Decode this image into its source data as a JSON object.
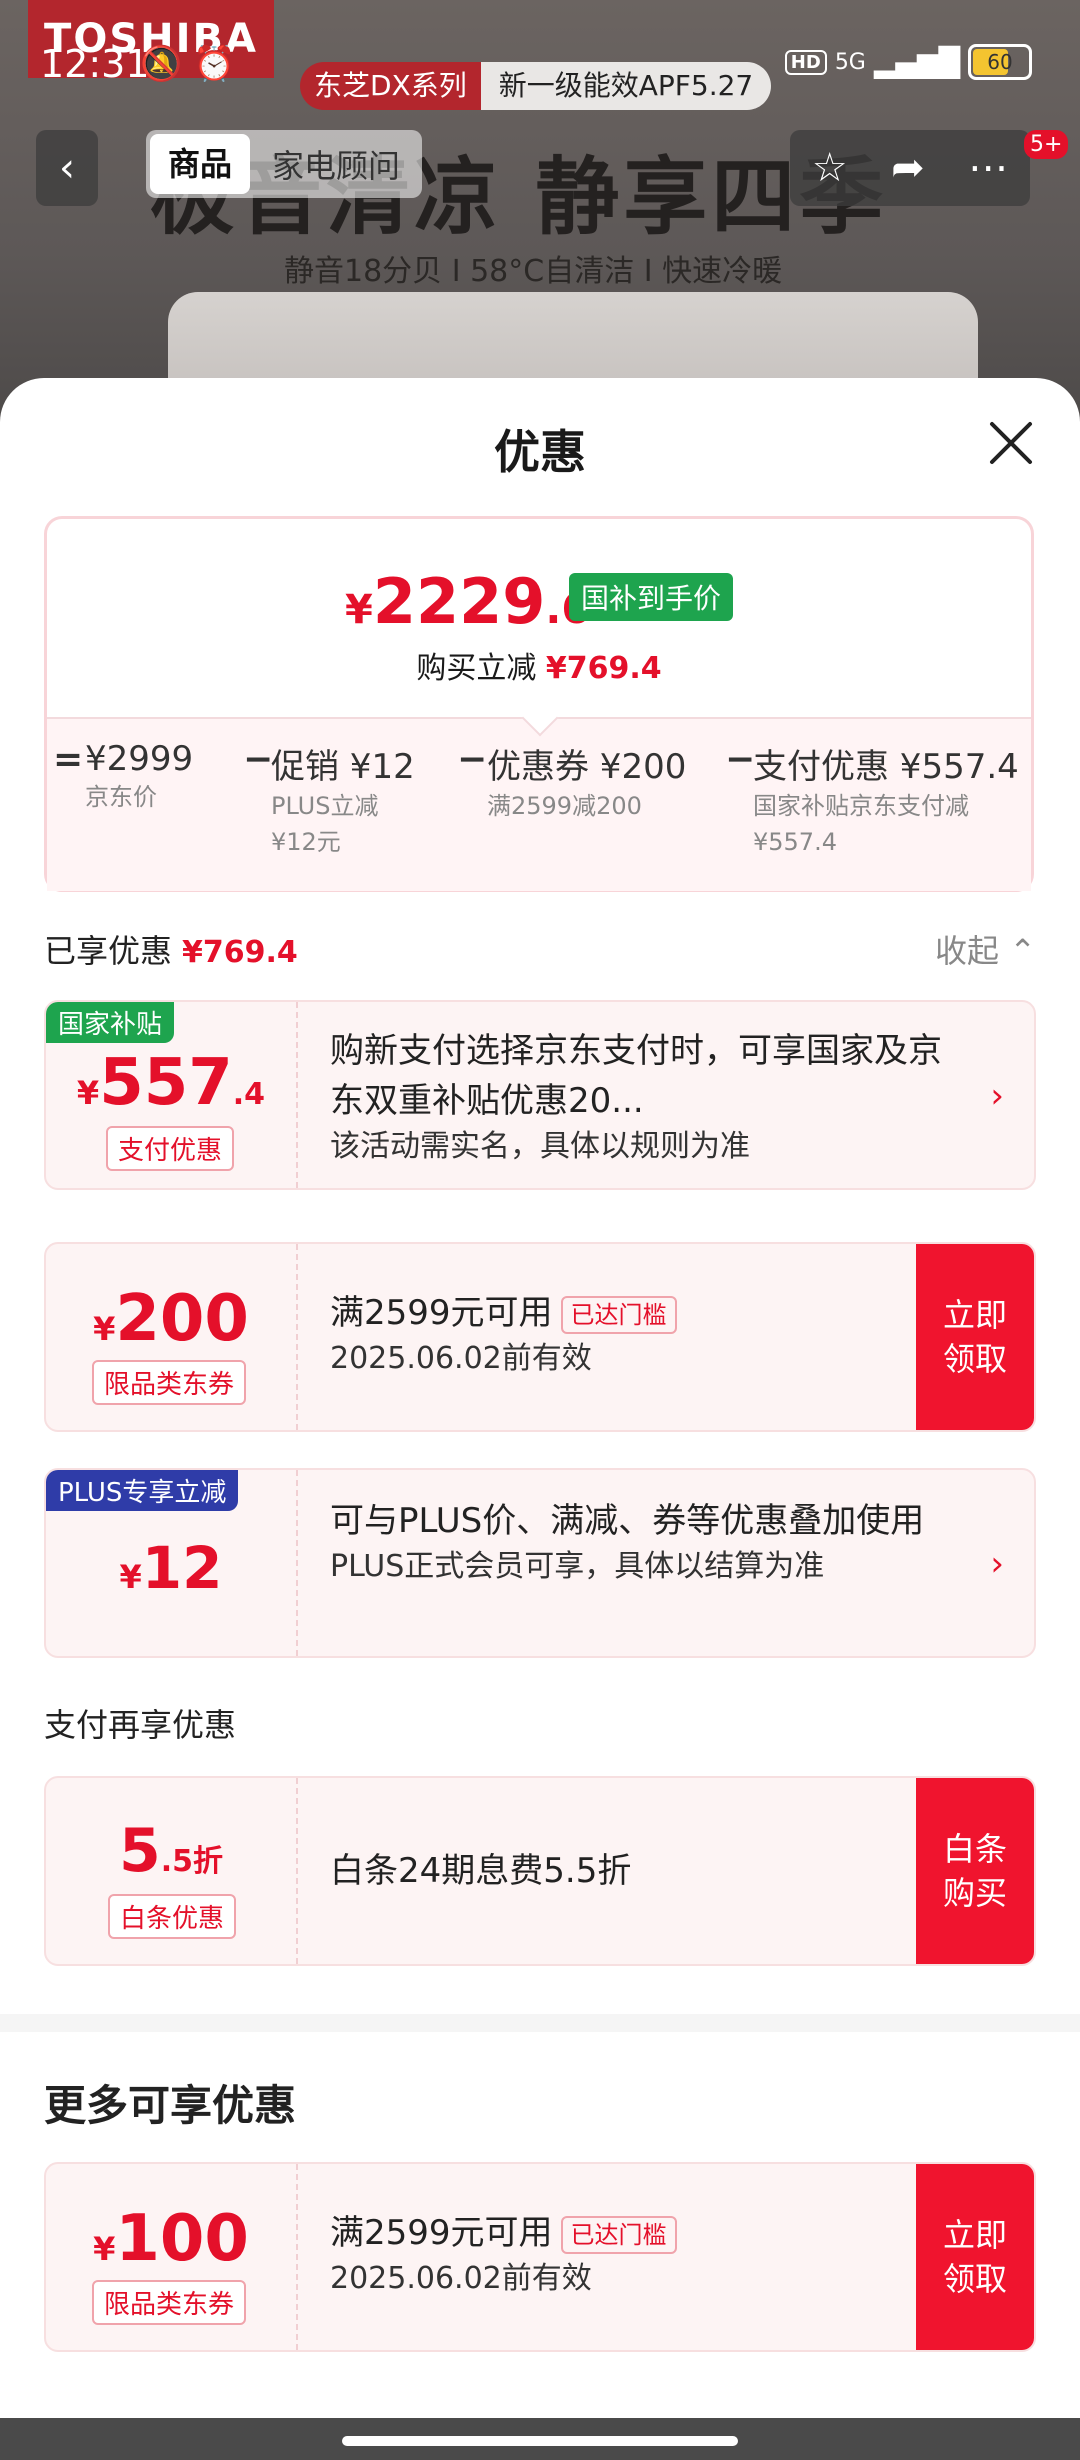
{
  "background": {
    "brand": "TOSHIBA",
    "series_tag": "东芝DX系列",
    "series_desc": "新一级能效APF5.27",
    "headline": "极音清凉 静享四季",
    "features": "静音18分贝 I 58°C自清洁 I 快速冷暖"
  },
  "status_bar": {
    "time": "12:31",
    "network": "5G",
    "hd": "HD",
    "battery": "60"
  },
  "nav": {
    "tab_product": "商品",
    "tab_advisor": "家电顾问",
    "badge": "5+"
  },
  "sheet": {
    "title": "优惠",
    "final_price": {
      "currency": "¥",
      "integer": "2229",
      "decimal": ".6",
      "tag": "国补到手价"
    },
    "reduce": {
      "label": "购买立减",
      "amount": "¥769.4"
    },
    "breakdown": {
      "eq": "=",
      "minus": "−",
      "items": [
        {
          "main": "¥2999",
          "sub1": "京东价",
          "sub2": ""
        },
        {
          "main": "促销 ¥12",
          "sub1": "PLUS立减",
          "sub2": "¥12元"
        },
        {
          "main": "优惠券 ¥200",
          "sub1": "满2599减200",
          "sub2": ""
        },
        {
          "main": "支付优惠 ¥557.4",
          "sub1": "国家补贴京东支付减",
          "sub2": "¥557.4"
        }
      ]
    },
    "enjoyed": {
      "label": "已享优惠",
      "amount": "¥769.4",
      "fold": "收起"
    },
    "cards": [
      {
        "ribbon": "国家补贴",
        "ribbon_color": "#1ea44e",
        "cur": "¥",
        "amount": "557",
        "dec": ".4",
        "label": "支付优惠",
        "main": "购新支付选择京东支付时，可享国家及京东双重补贴优惠20...",
        "sub": "该活动需实名，具体以规则为准"
      },
      {
        "cur": "¥",
        "amount": "200",
        "label": "限品类东券",
        "main": "满2599元可用",
        "threshold": "已达门槛",
        "sub": "2025.06.02前有效",
        "cta": "立即领取"
      },
      {
        "ribbon": "PLUS专享立减",
        "ribbon_color": "#2f3ca8",
        "cur": "¥",
        "amount": "12",
        "main": "可与PLUS价、满减、券等优惠叠加使用",
        "sub": "PLUS正式会员可享，具体以结算为准"
      }
    ],
    "pay_more_title": "支付再享优惠",
    "baitiao": {
      "amount": "5",
      "dec": ".5折",
      "label": "白条优惠",
      "main": "白条24期息费5.5折",
      "cta": "白条购买"
    }
  },
  "more": {
    "title": "更多可享优惠",
    "card": {
      "cur": "¥",
      "amount": "100",
      "label": "限品类东券",
      "main": "满2599元可用",
      "threshold": "已达门槛",
      "sub": "2025.06.02前有效",
      "cta": "立即领取"
    }
  }
}
